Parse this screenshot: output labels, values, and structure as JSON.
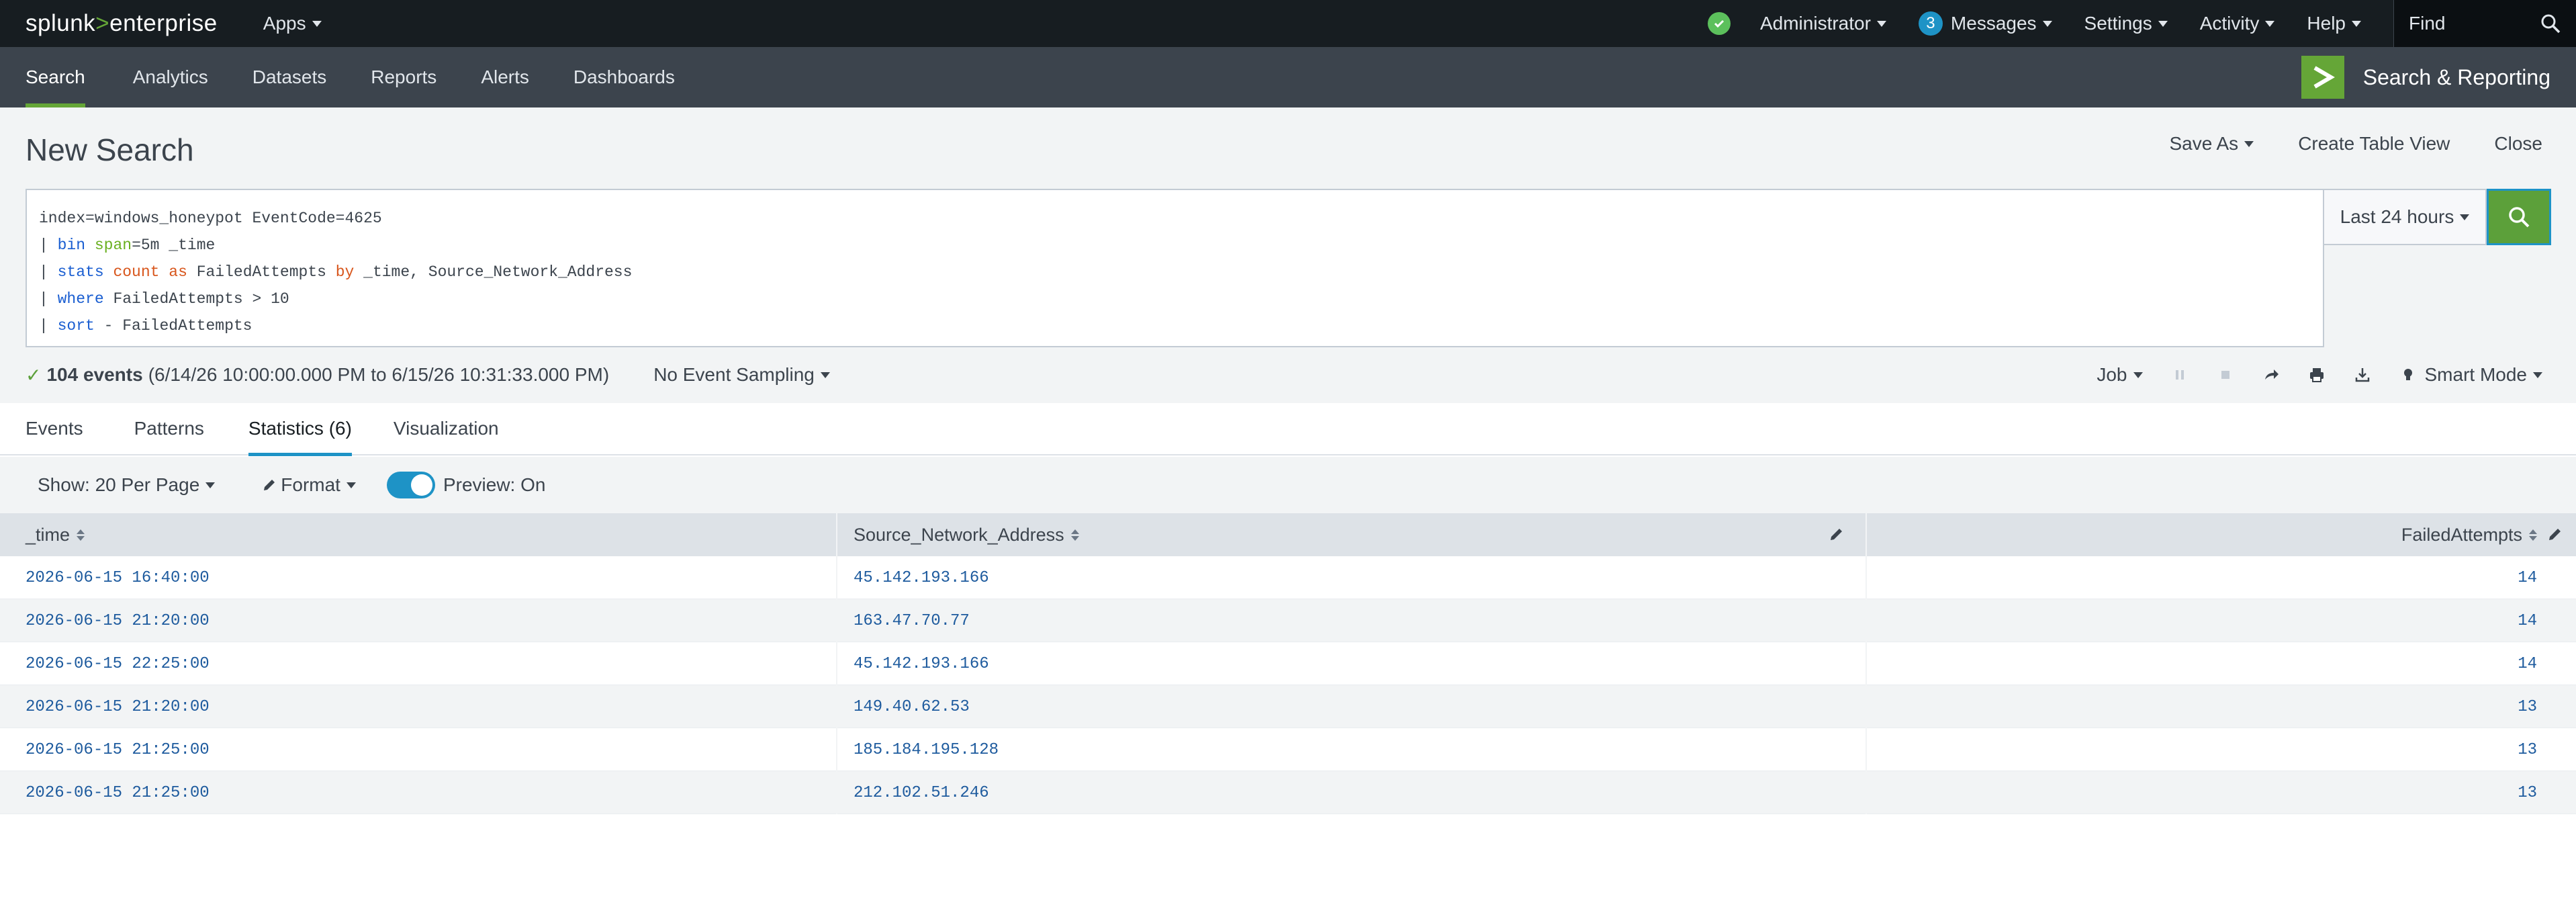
{
  "topbar": {
    "logo_splunk": "splunk",
    "logo_gt": ">",
    "logo_enterprise": "enterprise",
    "apps_label": "Apps",
    "status_icon": "check-circle-icon",
    "administrator_label": "Administrator",
    "messages_count": "3",
    "messages_label": "Messages",
    "settings_label": "Settings",
    "activity_label": "Activity",
    "help_label": "Help",
    "find_placeholder": "Find"
  },
  "appbar": {
    "tabs": [
      {
        "label": "Search"
      },
      {
        "label": "Analytics"
      },
      {
        "label": "Datasets"
      },
      {
        "label": "Reports"
      },
      {
        "label": "Alerts"
      },
      {
        "label": "Dashboards"
      }
    ],
    "app_title": "Search & Reporting",
    "accent_color": "#65a637"
  },
  "search": {
    "page_title": "New Search",
    "save_as": "Save As",
    "create_table_view": "Create Table View",
    "close": "Close",
    "query": {
      "line1": "index=windows_honeypot EventCode=4625",
      "pipe": "|",
      "bin": "bin",
      "span_kw": "span",
      "span_val": "=5m _time",
      "stats": "stats",
      "count": "count",
      "as": "as",
      "stats_rest1": " FailedAttempts ",
      "by": "by",
      "stats_rest2": " _time, Source_Network_Address",
      "where": "where",
      "where_rest": " FailedAttempts > 10",
      "sort": "sort",
      "sort_rest": " - FailedAttempts"
    },
    "time_range": "Last 24 hours",
    "event_count": "104 events",
    "event_range": "(6/14/26 10:00:00.000 PM to 6/15/26 10:31:33.000 PM)",
    "sampling": "No Event Sampling",
    "job_label": "Job",
    "mode_label": "Smart Mode"
  },
  "results": {
    "tabs": [
      {
        "label": "Events"
      },
      {
        "label": "Patterns"
      },
      {
        "label": "Statistics (6)"
      },
      {
        "label": "Visualization"
      }
    ],
    "show_per_page": "Show: 20 Per Page",
    "format_label": "Format",
    "preview_label": "Preview: On",
    "columns": [
      "_time",
      "Source_Network_Address",
      "FailedAttempts"
    ],
    "rows": [
      [
        "2026-06-15 16:40:00",
        "45.142.193.166",
        "14"
      ],
      [
        "2026-06-15 21:20:00",
        "163.47.70.77",
        "14"
      ],
      [
        "2026-06-15 22:25:00",
        "45.142.193.166",
        "14"
      ],
      [
        "2026-06-15 21:20:00",
        "149.40.62.53",
        "13"
      ],
      [
        "2026-06-15 21:25:00",
        "185.184.195.128",
        "13"
      ],
      [
        "2026-06-15 21:25:00",
        "212.102.51.246",
        "13"
      ]
    ]
  }
}
